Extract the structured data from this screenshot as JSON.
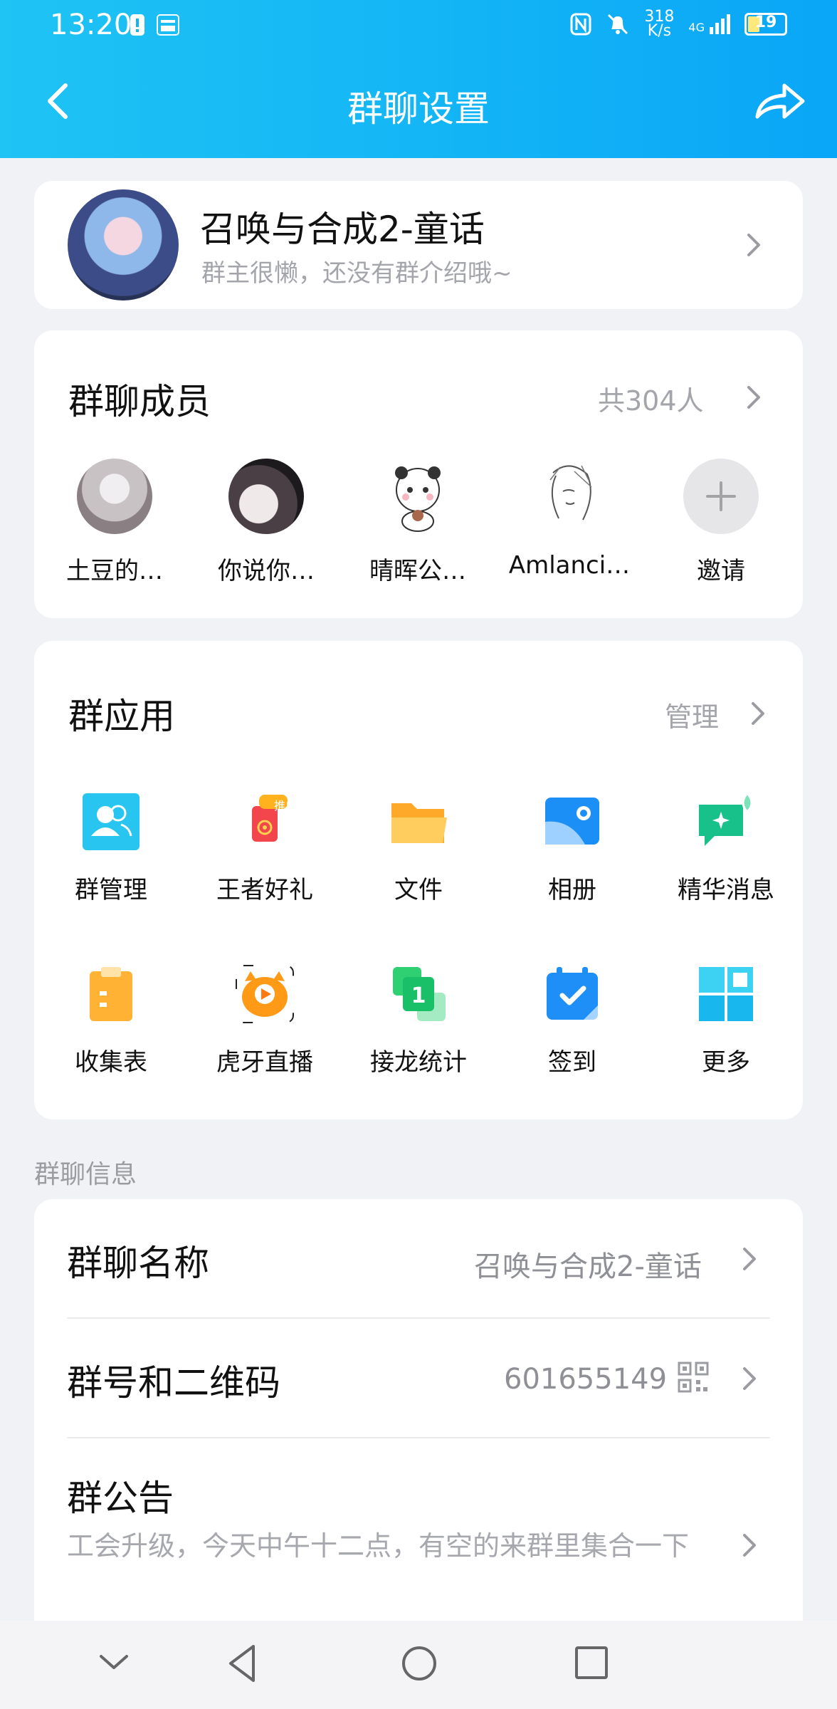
{
  "status_bar": {
    "time": "13:20",
    "speed_top": "318",
    "speed_bottom": "K/s",
    "network": "4G",
    "battery": "19"
  },
  "navbar": {
    "title": "群聊设置",
    "back_icon": "back-chevron-icon",
    "share_icon": "share-arrow-icon"
  },
  "group": {
    "name": "召唤与合成2-童话",
    "description": "群主很懒，还没有群介绍哦~"
  },
  "members": {
    "title": "群聊成员",
    "count": "共304人",
    "list": [
      {
        "name": "土豆的…"
      },
      {
        "name": "你说你…"
      },
      {
        "name": "晴晖公…"
      },
      {
        "name": "Amlanci…"
      },
      {
        "name": "邀请"
      }
    ]
  },
  "apps": {
    "title": "群应用",
    "manage": "管理",
    "badge": "推广",
    "items": [
      {
        "label": "群管理",
        "icon": "group-manage-icon"
      },
      {
        "label": "王者好礼",
        "icon": "gift-icon"
      },
      {
        "label": "文件",
        "icon": "folder-icon"
      },
      {
        "label": "相册",
        "icon": "album-icon"
      },
      {
        "label": "精华消息",
        "icon": "essence-message-icon"
      },
      {
        "label": "收集表",
        "icon": "clipboard-icon"
      },
      {
        "label": "虎牙直播",
        "icon": "huya-live-icon"
      },
      {
        "label": "接龙统计",
        "icon": "relay-stats-icon"
      },
      {
        "label": "签到",
        "icon": "calendar-checkin-icon"
      },
      {
        "label": "更多",
        "icon": "more-grid-icon"
      }
    ]
  },
  "info": {
    "caption": "群聊信息",
    "name_label": "群聊名称",
    "name_value": "召唤与合成2-童话",
    "number_label": "群号和二维码",
    "number_value": "601655149",
    "notice_label": "群公告",
    "notice_text": "工会升级，今天中午十二点，有空的来群里集合一下"
  },
  "colors": {
    "header_start": "#1fc3f4",
    "header_end": "#0aa6f7",
    "background": "#f1f2f6",
    "card": "#ffffff",
    "secondary_text": "#a3a5ab"
  }
}
